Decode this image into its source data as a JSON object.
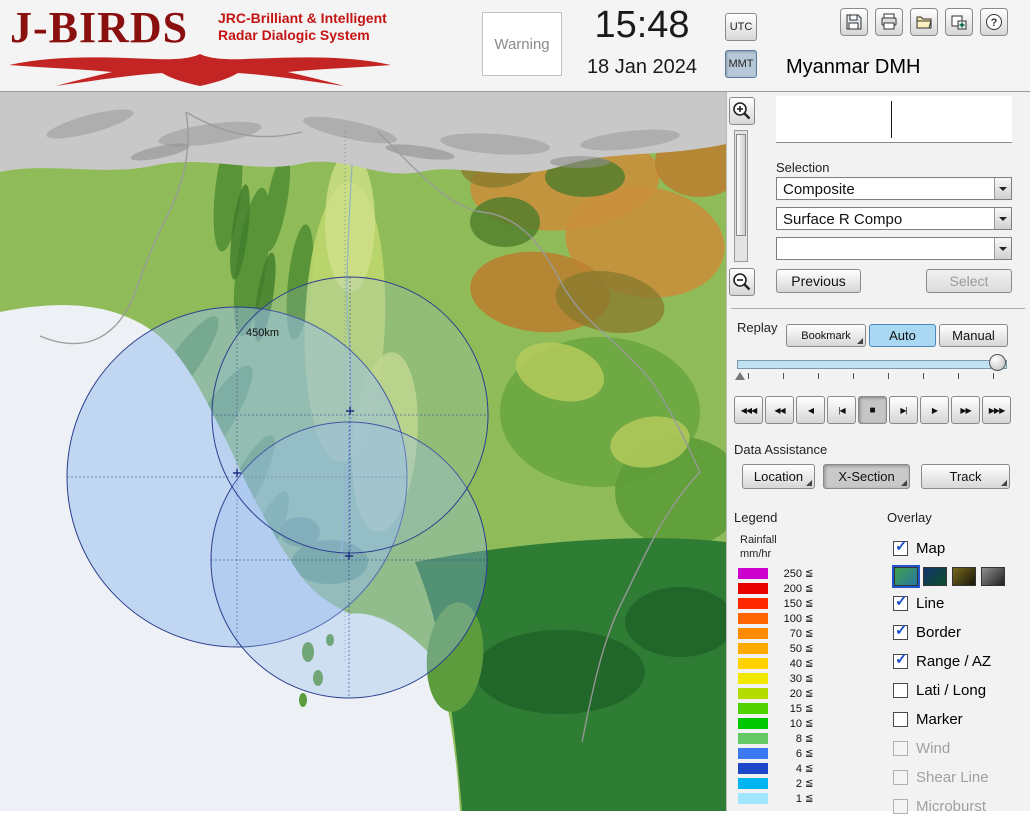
{
  "header": {
    "logo": {
      "title": "J-BIRDS",
      "subtitle1": "JRC-Brilliant & Intelligent",
      "subtitle2": "Radar  Dialogic  System"
    },
    "warning_label": "Warning",
    "clock": {
      "time": "15:48",
      "date": "18 Jan 2024"
    },
    "timezone": {
      "utc": "UTC",
      "mmt": "MMT",
      "selected": "MMT"
    },
    "toolbar": {
      "buttons": [
        "save",
        "print",
        "open",
        "import",
        "help"
      ]
    },
    "org_name": "Myanmar DMH"
  },
  "map": {
    "range_label": "450km"
  },
  "selection": {
    "label": "Selection",
    "combo1": "Composite",
    "combo2": "Surface R Compo",
    "combo3": "",
    "previous": "Previous",
    "select": "Select",
    "select_enabled": false
  },
  "replay": {
    "label": "Replay",
    "bookmark": "Bookmark",
    "auto": "Auto",
    "manual": "Manual",
    "selected_mode": "Auto",
    "controls": [
      "◀◀◀",
      "◀◀",
      "◀",
      "|◀",
      "■",
      "▶|",
      "▶",
      "▶▶",
      "▶▶▶"
    ],
    "control_names": [
      "fast-rewind",
      "rewind",
      "step-back",
      "go-start",
      "stop",
      "go-end",
      "play",
      "forward",
      "fast-forward"
    ],
    "pressed_index": 4
  },
  "data_assistance": {
    "label": "Data Assistance",
    "buttons": [
      "Location",
      "X-Section",
      "Track"
    ],
    "pressed": "X-Section"
  },
  "legend": {
    "title": "Legend",
    "unit_line1": "Rainfall",
    "unit_line2": "mm/hr",
    "leq": "≦",
    "rows": [
      {
        "value": "250",
        "color": "#cc00cc"
      },
      {
        "value": "200",
        "color": "#e60000"
      },
      {
        "value": "150",
        "color": "#ff2800"
      },
      {
        "value": "100",
        "color": "#ff6400"
      },
      {
        "value": "70",
        "color": "#ff8c00"
      },
      {
        "value": "50",
        "color": "#ffaa00"
      },
      {
        "value": "40",
        "color": "#ffd200"
      },
      {
        "value": "30",
        "color": "#f0e800"
      },
      {
        "value": "20",
        "color": "#b4dc00"
      },
      {
        "value": "15",
        "color": "#50d200"
      },
      {
        "value": "10",
        "color": "#00c800"
      },
      {
        "value": "8",
        "color": "#64c864"
      },
      {
        "value": "6",
        "color": "#3c78f0"
      },
      {
        "value": "4",
        "color": "#1e46c8"
      },
      {
        "value": "2",
        "color": "#00b4f0"
      },
      {
        "value": "1",
        "color": "#a0e6ff"
      }
    ]
  },
  "overlay": {
    "title": "Overlay",
    "map_styles": [
      {
        "name": "green-terrain",
        "from": "#3fa04a",
        "to": "#2878a0",
        "selected": true
      },
      {
        "name": "dark-blue-green",
        "from": "#14326e",
        "to": "#0c5028",
        "selected": false
      },
      {
        "name": "olive-dark",
        "from": "#7a6a1e",
        "to": "#16160a",
        "selected": false
      },
      {
        "name": "gray-dark",
        "from": "#909090",
        "to": "#202020",
        "selected": false
      }
    ],
    "items": [
      {
        "label": "Map",
        "checked": true,
        "enabled": true
      },
      {
        "label": "Line",
        "checked": true,
        "enabled": true
      },
      {
        "label": "Border",
        "checked": true,
        "enabled": true
      },
      {
        "label": "Range / AZ",
        "checked": true,
        "enabled": true
      },
      {
        "label": "Lati / Long",
        "checked": false,
        "enabled": true
      },
      {
        "label": "Marker",
        "checked": false,
        "enabled": true
      },
      {
        "label": "Wind",
        "checked": false,
        "enabled": false
      },
      {
        "label": "Shear Line",
        "checked": false,
        "enabled": false
      },
      {
        "label": "Microburst",
        "checked": false,
        "enabled": false
      }
    ]
  },
  "colors": {
    "auto_selected": "#a9d9f2",
    "timeline_track": "#bfe3f2",
    "logo_dark_red": "#8a0f0f",
    "logo_red": "#c41414"
  }
}
